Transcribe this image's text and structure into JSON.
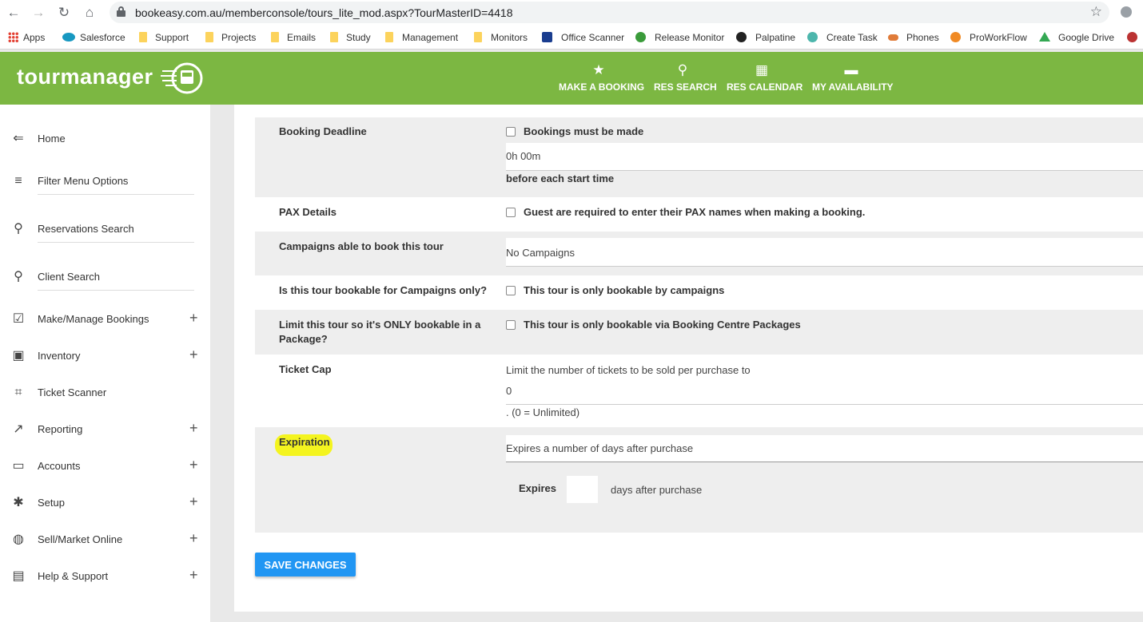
{
  "browser": {
    "url": "bookeasy.com.au/memberconsole/tours_lite_mod.aspx?TourMasterID=4418",
    "bookmarks": [
      {
        "label": "Apps",
        "icon": "apps-grid-icon"
      },
      {
        "label": "Salesforce",
        "icon": "salesforce-cloud-icon"
      },
      {
        "label": "Support",
        "icon": "folder-icon"
      },
      {
        "label": "Projects",
        "icon": "folder-icon"
      },
      {
        "label": "Emails",
        "icon": "folder-icon"
      },
      {
        "label": "Study",
        "icon": "folder-icon"
      },
      {
        "label": "Management",
        "icon": "folder-icon"
      },
      {
        "label": "Monitors",
        "icon": "folder-icon"
      },
      {
        "label": "Office Scanner",
        "icon": "hp-icon"
      },
      {
        "label": "Release Monitor",
        "icon": "mushroom-icon"
      },
      {
        "label": "Palpatine",
        "icon": "deathstar-icon"
      },
      {
        "label": "Create Task",
        "icon": "task-icon"
      },
      {
        "label": "Phones",
        "icon": "phones-icon"
      },
      {
        "label": "ProWorkFlow",
        "icon": "gear-orange-icon"
      },
      {
        "label": "Google Drive",
        "icon": "google-drive-icon"
      }
    ]
  },
  "header": {
    "logo": "tourmanager",
    "nav": [
      {
        "label": "MAKE A BOOKING",
        "icon": "★"
      },
      {
        "label": "RES SEARCH",
        "icon": "⚲"
      },
      {
        "label": "RES CALENDAR",
        "icon": "▦"
      },
      {
        "label": "MY AVAILABILITY",
        "icon": "▬"
      }
    ]
  },
  "sidebar": {
    "items": [
      {
        "label": "Home",
        "icon": "⇐",
        "expandable": false
      },
      {
        "label": "Filter Menu Options",
        "icon": "≡",
        "expandable": false
      },
      {
        "label": "Reservations Search",
        "icon": "⚲",
        "expandable": false
      },
      {
        "label": "Client Search",
        "icon": "⚲",
        "expandable": false
      },
      {
        "label": "Make/Manage Bookings",
        "icon": "☑",
        "expandable": true
      },
      {
        "label": "Inventory",
        "icon": "▣",
        "expandable": true
      },
      {
        "label": "Ticket Scanner",
        "icon": "⌗",
        "expandable": false
      },
      {
        "label": "Reporting",
        "icon": "↗",
        "expandable": true
      },
      {
        "label": "Accounts",
        "icon": "▭",
        "expandable": true
      },
      {
        "label": "Setup",
        "icon": "✱",
        "expandable": true
      },
      {
        "label": "Sell/Market Online",
        "icon": "◍",
        "expandable": true
      },
      {
        "label": "Help & Support",
        "icon": "▤",
        "expandable": true
      }
    ],
    "plus": "+"
  },
  "form": {
    "booking_deadline": {
      "label": "Booking Deadline",
      "checkbox_label": "Bookings must be made",
      "value": "0h 00m",
      "suffix": "before each start time"
    },
    "pax_details": {
      "label": "PAX Details",
      "checkbox_label": "Guest are required to enter their PAX names when making a booking."
    },
    "campaigns": {
      "label": "Campaigns able to book this tour",
      "value": "No Campaigns"
    },
    "campaigns_only": {
      "label": "Is this tour bookable for Campaigns only?",
      "checkbox_label": "This tour is only bookable by campaigns"
    },
    "package_only": {
      "label_line1": "Limit this tour so it's ONLY bookable in a",
      "label_line2": "Package?",
      "checkbox_label": "This tour is only bookable via Booking Centre Packages"
    },
    "ticket_cap": {
      "label": "Ticket Cap",
      "prefix": "Limit the number of tickets to be sold per purchase to",
      "value": "0",
      "suffix": ". (0 = Unlimited)"
    },
    "expiration": {
      "label": "Expiration",
      "mode": "Expires a number of days after purchase",
      "expires_label": "Expires",
      "days_value": "",
      "days_suffix": "days after purchase"
    },
    "save_label": "SAVE CHANGES"
  }
}
